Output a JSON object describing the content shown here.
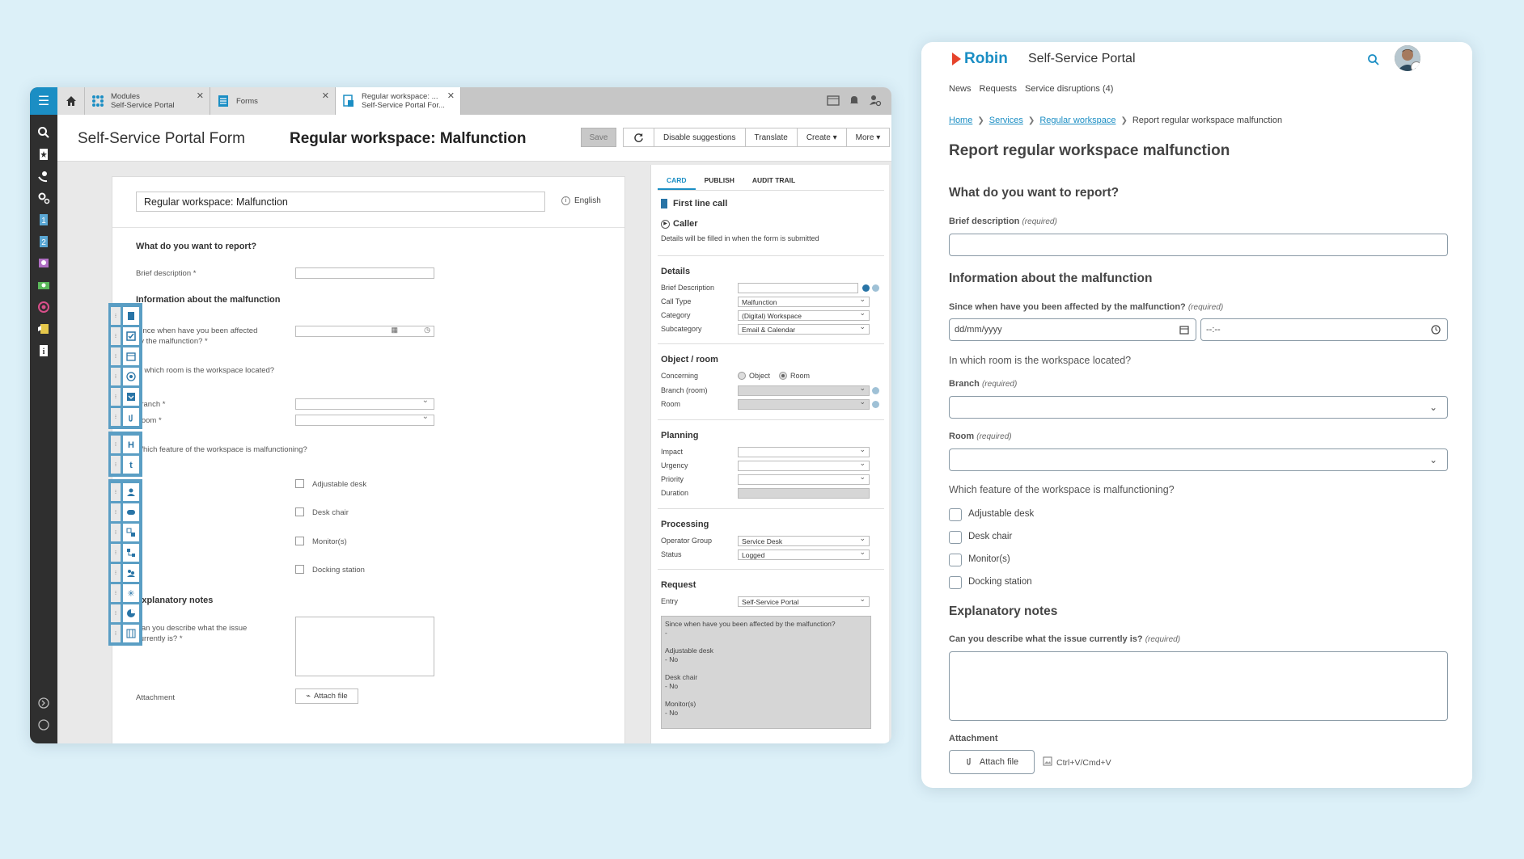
{
  "left_window": {
    "tabs": [
      {
        "line1": "Modules",
        "line2": "Self-Service Portal"
      },
      {
        "line1": "Forms",
        "line2": ""
      },
      {
        "line1": "Regular workspace: ...",
        "line2": "Self-Service Portal For..."
      }
    ],
    "header": {
      "title": "Self-Service Portal Form",
      "subtitle": "Regular workspace: Malfunction",
      "save": "Save",
      "buttons": [
        "Disable suggestions",
        "Translate",
        "Create",
        "More"
      ]
    },
    "form": {
      "title_value": "Regular workspace: Malfunction",
      "language": "English",
      "section1": "What do you want to report?",
      "brief_description": "Brief description *",
      "section2": "Information about the malfunction",
      "since_when_1": "Since when have you been affected",
      "since_when_2": "by the malfunction? *",
      "which_room": "In which room is the workspace located?",
      "branch": "Branch *",
      "room": "Room *",
      "which_feature": "Which feature of the workspace is malfunctioning?",
      "options": [
        "Adjustable desk",
        "Desk chair",
        "Monitor(s)",
        "Docking station"
      ],
      "section3": "Explanatory notes",
      "describe_1": "Can you describe what the issue",
      "describe_2": "currently is? *",
      "attachment": "Attachment",
      "attach_file": "Attach file"
    },
    "card": {
      "tabs": [
        "CARD",
        "PUBLISH",
        "AUDIT TRAIL"
      ],
      "first_line_call": "First line call",
      "caller": "Caller",
      "caller_note": "Details will be filled in when the form is submitted",
      "details_heading": "Details",
      "brief_desc_label": "Brief Description",
      "call_type_label": "Call Type",
      "call_type": "Malfunction",
      "category_label": "Category",
      "category": "(Digital) Workspace",
      "subcategory_label": "Subcategory",
      "subcategory": "Email & Calendar",
      "object_heading": "Object / room",
      "concerning_label": "Concerning",
      "object_opt": "Object",
      "room_opt": "Room",
      "branch_room_label": "Branch (room)",
      "room_label": "Room",
      "planning_heading": "Planning",
      "impact_label": "Impact",
      "urgency_label": "Urgency",
      "priority_label": "Priority",
      "duration_label": "Duration",
      "processing_heading": "Processing",
      "operator_group_label": "Operator Group",
      "operator_group": "Service Desk",
      "status_label": "Status",
      "status": "Logged",
      "request_heading": "Request",
      "entry_label": "Entry",
      "entry": "Self-Service Portal",
      "request_text": [
        "Since when have you been affected by the malfunction?",
        "-",
        "",
        "Adjustable desk",
        "- No",
        "",
        "Desk chair",
        "- No",
        "",
        "Monitor(s)",
        "- No"
      ]
    }
  },
  "right_window": {
    "logo": "Robin",
    "portal_title": "Self-Service Portal",
    "nav": [
      "News",
      "Requests",
      "Service disruptions (4)"
    ],
    "breadcrumb": [
      "Home",
      "Services",
      "Regular workspace",
      "Report regular workspace malfunction"
    ],
    "page_title": "Report regular workspace malfunction",
    "section1": "What do you want to report?",
    "brief_label": "Brief description",
    "required": "(required)",
    "section2": "Information about the malfunction",
    "since_label": "Since when have you been affected by the malfunction?",
    "date_placeholder": "dd/mm/yyyy",
    "time_placeholder": "--:--",
    "which_room": "In which room is the workspace located?",
    "branch_label": "Branch",
    "room_label": "Room",
    "which_feature": "Which feature of the workspace is malfunctioning?",
    "options": [
      "Adjustable desk",
      "Desk chair",
      "Monitor(s)",
      "Docking station"
    ],
    "section3": "Explanatory notes",
    "describe_label": "Can you describe what the issue currently is?",
    "attachment_label": "Attachment",
    "attach_file": "Attach file",
    "paste_hint": "Ctrl+V/Cmd+V"
  }
}
